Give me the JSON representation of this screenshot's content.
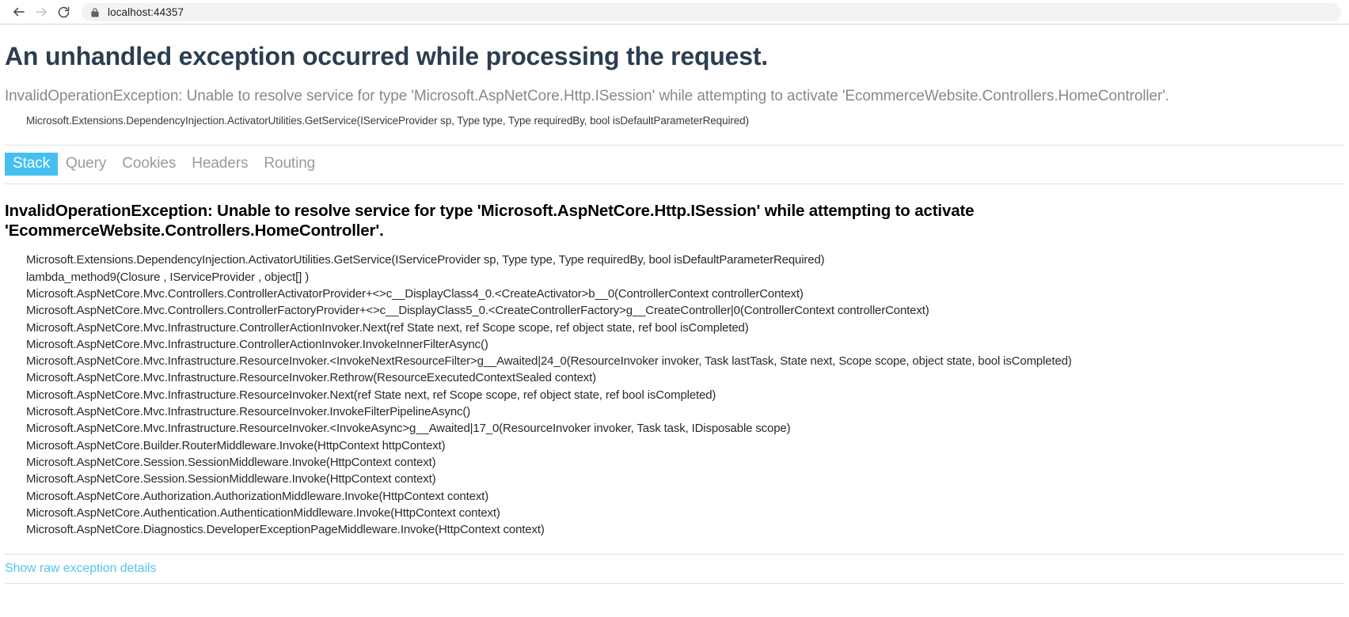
{
  "browser": {
    "back_icon": "back-arrow-icon",
    "forward_icon": "forward-arrow-icon",
    "reload_icon": "reload-icon",
    "lock_icon": "lock-icon",
    "url": "localhost:44357"
  },
  "page": {
    "title": "An unhandled exception occurred while processing the request.",
    "summary": "InvalidOperationException: Unable to resolve service for type 'Microsoft.AspNetCore.Http.ISession' while attempting to activate 'EcommerceWebsite.Controllers.HomeController'.",
    "top_frame": "Microsoft.Extensions.DependencyInjection.ActivatorUtilities.GetService(IServiceProvider sp, Type type, Type requiredBy, bool isDefaultParameterRequired)"
  },
  "tabs": {
    "active_index": 0,
    "items": [
      {
        "label": "Stack"
      },
      {
        "label": "Query"
      },
      {
        "label": "Cookies"
      },
      {
        "label": "Headers"
      },
      {
        "label": "Routing"
      }
    ]
  },
  "stack": {
    "heading": "InvalidOperationException: Unable to resolve service for type 'Microsoft.AspNetCore.Http.ISession' while attempting to activate 'EcommerceWebsite.Controllers.HomeController'.",
    "frames": [
      "Microsoft.Extensions.DependencyInjection.ActivatorUtilities.GetService(IServiceProvider sp, Type type, Type requiredBy, bool isDefaultParameterRequired)",
      "lambda_method9(Closure , IServiceProvider , object[] )",
      "Microsoft.AspNetCore.Mvc.Controllers.ControllerActivatorProvider+<>c__DisplayClass4_0.<CreateActivator>b__0(ControllerContext controllerContext)",
      "Microsoft.AspNetCore.Mvc.Controllers.ControllerFactoryProvider+<>c__DisplayClass5_0.<CreateControllerFactory>g__CreateController|0(ControllerContext controllerContext)",
      "Microsoft.AspNetCore.Mvc.Infrastructure.ControllerActionInvoker.Next(ref State next, ref Scope scope, ref object state, ref bool isCompleted)",
      "Microsoft.AspNetCore.Mvc.Infrastructure.ControllerActionInvoker.InvokeInnerFilterAsync()",
      "Microsoft.AspNetCore.Mvc.Infrastructure.ResourceInvoker.<InvokeNextResourceFilter>g__Awaited|24_0(ResourceInvoker invoker, Task lastTask, State next, Scope scope, object state, bool isCompleted)",
      "Microsoft.AspNetCore.Mvc.Infrastructure.ResourceInvoker.Rethrow(ResourceExecutedContextSealed context)",
      "Microsoft.AspNetCore.Mvc.Infrastructure.ResourceInvoker.Next(ref State next, ref Scope scope, ref object state, ref bool isCompleted)",
      "Microsoft.AspNetCore.Mvc.Infrastructure.ResourceInvoker.InvokeFilterPipelineAsync()",
      "Microsoft.AspNetCore.Mvc.Infrastructure.ResourceInvoker.<InvokeAsync>g__Awaited|17_0(ResourceInvoker invoker, Task task, IDisposable scope)",
      "Microsoft.AspNetCore.Builder.RouterMiddleware.Invoke(HttpContext httpContext)",
      "Microsoft.AspNetCore.Session.SessionMiddleware.Invoke(HttpContext context)",
      "Microsoft.AspNetCore.Session.SessionMiddleware.Invoke(HttpContext context)",
      "Microsoft.AspNetCore.Authorization.AuthorizationMiddleware.Invoke(HttpContext context)",
      "Microsoft.AspNetCore.Authentication.AuthenticationMiddleware.Invoke(HttpContext context)",
      "Microsoft.AspNetCore.Diagnostics.DeveloperExceptionPageMiddleware.Invoke(HttpContext context)"
    ]
  },
  "footer": {
    "raw_details_label": "Show raw exception details"
  },
  "colors": {
    "accent": "#44c0f0",
    "link": "#55c5f0",
    "title": "#2c3e50",
    "summary": "#7f8c8d",
    "tab_inactive": "#9b9b9b"
  }
}
